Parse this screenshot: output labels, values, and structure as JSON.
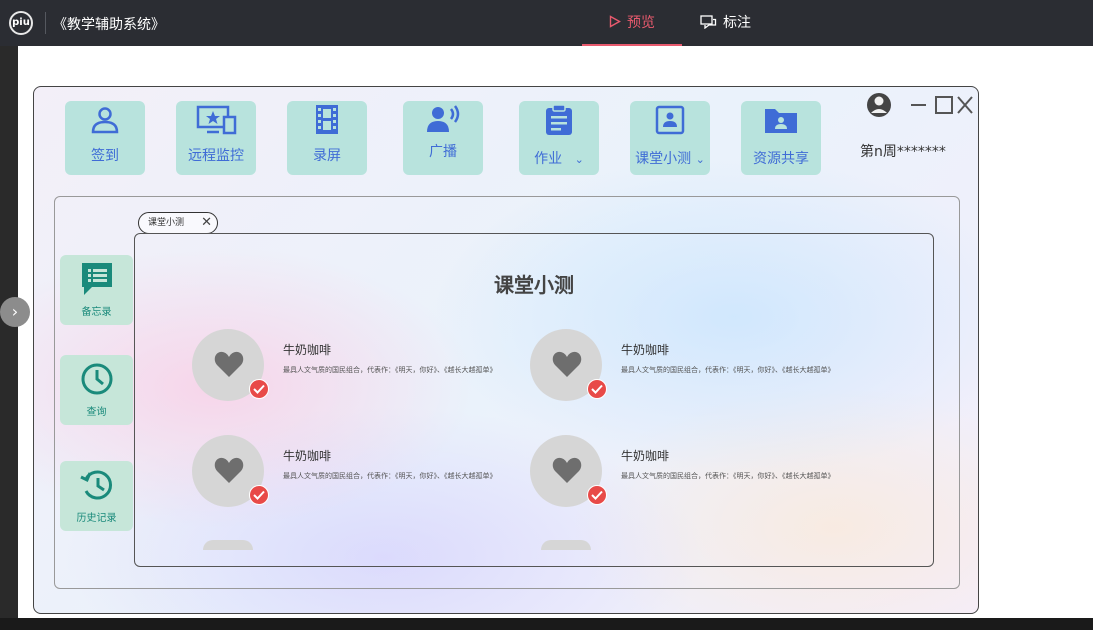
{
  "topbar": {
    "logo_text": "piu",
    "app_title": "《教学辅助系统》",
    "tabs": [
      {
        "label": "预览",
        "icon": "play-icon",
        "active": true
      },
      {
        "label": "标注",
        "icon": "comment-icon",
        "active": false
      }
    ]
  },
  "toolbar": {
    "items": [
      {
        "label": "签到",
        "icon": "user-icon"
      },
      {
        "label": "远程监控",
        "icon": "monitor-icon"
      },
      {
        "label": "录屏",
        "icon": "film-icon"
      },
      {
        "label": "广播",
        "icon": "broadcast-icon"
      },
      {
        "label": "作业",
        "icon": "clipboard-icon",
        "dropdown": "⌄"
      },
      {
        "label": "课堂小测",
        "icon": "portrait-icon",
        "dropdown": "⌄"
      },
      {
        "label": "资源共享",
        "icon": "folder-icon"
      }
    ]
  },
  "window": {
    "user_label": "第n周*******"
  },
  "sidebar": {
    "items": [
      {
        "label": "备忘录",
        "icon": "memo-icon"
      },
      {
        "label": "查询",
        "icon": "clock-icon"
      },
      {
        "label": "历史记录",
        "icon": "history-icon"
      }
    ]
  },
  "open_tab": {
    "label": "课堂小测",
    "close": "✕"
  },
  "content": {
    "title": "课堂小测",
    "cards": [
      {
        "name": "牛奶咖啡",
        "desc": "最具人文气质的国民组合，代表作：《明天，你好》、《越长大越孤单》"
      },
      {
        "name": "牛奶咖啡",
        "desc": "最具人文气质的国民组合，代表作：《明天，你好》、《越长大越孤单》"
      },
      {
        "name": "牛奶咖啡",
        "desc": "最具人文气质的国民组合，代表作：《明天，你好》、《越长大越孤单》"
      },
      {
        "name": "牛奶咖啡",
        "desc": "最具人文气质的国民组合，代表作：《明天，你好》、《越长大越孤单》"
      }
    ]
  },
  "colors": {
    "accent_pink": "#e85a6e",
    "tool_bg": "#b8e3dd",
    "tool_text": "#3f6cd6",
    "side_bg": "#c6e6d9",
    "badge": "#e84a48"
  }
}
